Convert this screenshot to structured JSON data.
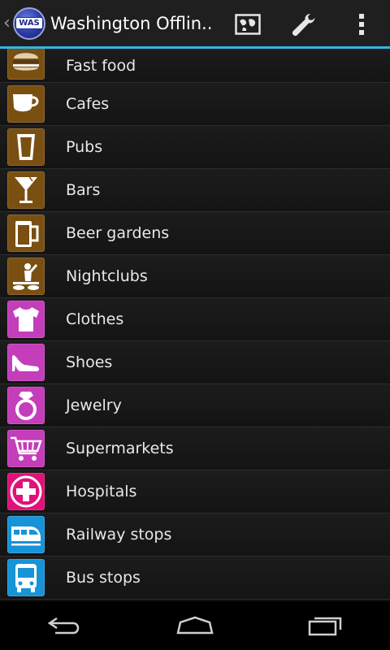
{
  "action_bar": {
    "title": "Washington Offlin...",
    "logo_text": "WAS",
    "actions": [
      "map-icon",
      "wrench-icon",
      "overflow-menu-icon"
    ]
  },
  "colors": {
    "accent": "#33b5e5",
    "food": "#7a4f12",
    "shop": "#c43dba",
    "health": "#e0117a",
    "transport": "#1793d8"
  },
  "categories": [
    {
      "label": "Fast food",
      "icon": "burger-icon",
      "group": "food"
    },
    {
      "label": "Cafes",
      "icon": "coffee-cup-icon",
      "group": "food"
    },
    {
      "label": "Pubs",
      "icon": "pint-glass-icon",
      "group": "food"
    },
    {
      "label": "Bars",
      "icon": "cocktail-glass-icon",
      "group": "food"
    },
    {
      "label": "Beer gardens",
      "icon": "beer-mug-icon",
      "group": "food"
    },
    {
      "label": "Nightclubs",
      "icon": "dj-icon",
      "group": "food"
    },
    {
      "label": "Clothes",
      "icon": "tshirt-icon",
      "group": "shop"
    },
    {
      "label": "Shoes",
      "icon": "high-heel-icon",
      "group": "shop"
    },
    {
      "label": "Jewelry",
      "icon": "ring-icon",
      "group": "shop"
    },
    {
      "label": "Supermarkets",
      "icon": "shopping-cart-icon",
      "group": "shop"
    },
    {
      "label": "Hospitals",
      "icon": "medical-cross-icon",
      "group": "health"
    },
    {
      "label": "Railway stops",
      "icon": "train-icon",
      "group": "transport"
    },
    {
      "label": "Bus stops",
      "icon": "bus-icon",
      "group": "transport"
    }
  ],
  "nav": [
    "back-icon",
    "home-icon",
    "recents-icon"
  ]
}
